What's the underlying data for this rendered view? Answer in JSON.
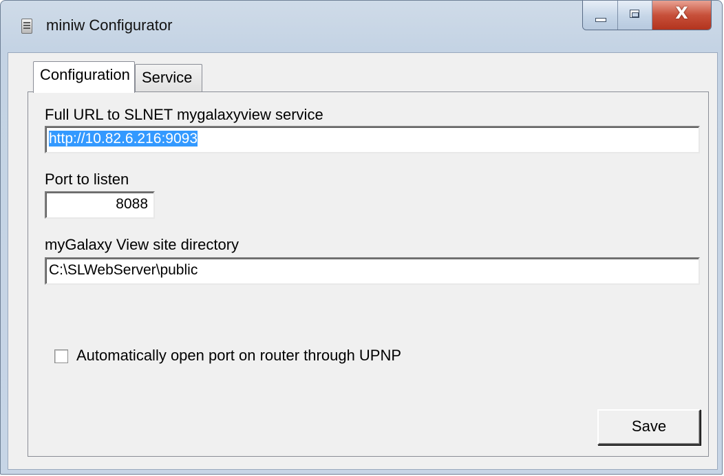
{
  "window": {
    "title": "miniw Configurator",
    "icon": "app-document-icon",
    "controls": {
      "minimize": "minimize-icon",
      "maximize": "maximize-icon",
      "close": "close-icon",
      "close_glyph": "X"
    }
  },
  "tabs": [
    {
      "label": "Configuration",
      "selected": true
    },
    {
      "label": "Service",
      "selected": false
    }
  ],
  "form": {
    "url": {
      "label": "Full URL to SLNET mygalaxyview service",
      "value": "http://10.82.6.216:9093"
    },
    "port": {
      "label": "Port to listen",
      "value": "8088"
    },
    "site_dir": {
      "label": "myGalaxy View site directory",
      "value": "C:\\SLWebServer\\public"
    },
    "upnp": {
      "label": "Automatically open port on router through UPNP",
      "checked": false
    },
    "save_label": "Save"
  },
  "colors": {
    "selection": "#3399ff",
    "close_button": "#c7503a"
  }
}
